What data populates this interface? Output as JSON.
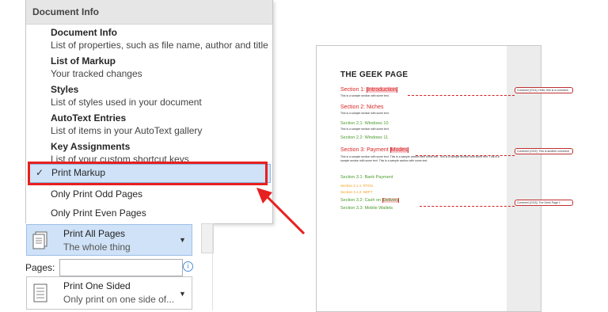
{
  "menu": {
    "header": "Document Info",
    "items": [
      {
        "title": "Document Info",
        "desc": "List of properties, such as file name, author and title"
      },
      {
        "title": "List of Markup",
        "desc": "Your tracked changes"
      },
      {
        "title": "Styles",
        "desc": "List of styles used in your document"
      },
      {
        "title": "AutoText Entries",
        "desc": "List of items in your AutoText gallery"
      },
      {
        "title": "Key Assignments",
        "desc": "List of your custom shortcut keys"
      }
    ],
    "print_markup": "Print Markup",
    "odd_pages": "Only Print Odd Pages",
    "even_pages": "Only Print Even Pages"
  },
  "settings": {
    "pages_setting_title": "Print All Pages",
    "pages_setting_sub": "The whole thing",
    "pages_label": "Pages:",
    "pages_value": "",
    "sided_title": "Print One Sided",
    "sided_sub": "Only print on one side of..."
  },
  "preview": {
    "title": "THE GEEK PAGE",
    "s1_prefix": "Section 1: ",
    "s1_hl": "Introduction",
    "s1_body": "This is a sample section with some text.",
    "s2": "Section 2: Niches",
    "s2_body": "This is a sample section with some text.",
    "s21": "Section 2.1: Windows 10",
    "s21_body": "This is a sample section with some text.",
    "s22": "Section 2.2: Windows 11",
    "s3_prefix": "Section 3: Payment ",
    "s3_hl": "Modes",
    "s3_body": "This is a sample section with some text. This is a sample section with some text. This is a sample section with some text. This is a sample section with some text. This is a sample section with some text.",
    "s31": "Section 3.1: Bank Payment",
    "s311": "Section 3.1.1: RTGS",
    "s312": "Section 3.1.2: NEFT",
    "s32_prefix": "Section 3.2: Cash on ",
    "s32_hl": "Delivery",
    "s33": "Section 3.3: Mobile Wallets",
    "comments": [
      "Comment [GG1]: Hello, this is a comment",
      "Comment [GG2]: This is another comment",
      "Comment [GG3]: The Geek Page 1"
    ]
  },
  "colors": {
    "highlight": "#cfe2f7",
    "callout": "#e81f1f"
  }
}
